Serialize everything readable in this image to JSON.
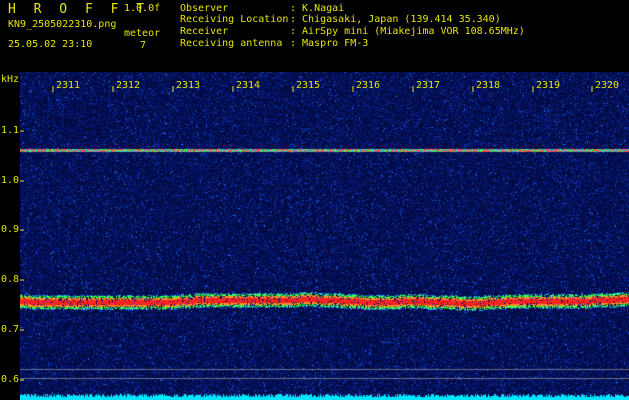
{
  "header": {
    "app_title": "H R O F F T",
    "version": "1.0.0f",
    "file_name": "KN9_2505022310.png",
    "timestamp": "25.05.02 23:10",
    "meteor_label": "meteor",
    "meteor_count": "7",
    "metadata": [
      {
        "label": "Observer",
        "value": ": K.Nagai"
      },
      {
        "label": "Receiving Location",
        "value": ": Chigasaki, Japan (139.414 35.340)"
      },
      {
        "label": "Receiver",
        "value": ": AirSpy mini (Miakejima VOR 108.65MHz)"
      },
      {
        "label": "Receiving antenna",
        "value": ": Maspro FM-3"
      }
    ]
  },
  "axes": {
    "y_unit": "kHz",
    "y_ticks": [
      "1.1",
      "1.0",
      "0.9",
      "0.8",
      "0.7",
      "0.6"
    ],
    "x_ticks": [
      "2311",
      "2312",
      "2313",
      "2314",
      "2315",
      "2316",
      "2317",
      "2318",
      "2319",
      "2320"
    ]
  },
  "colors": {
    "text": "#e6e600",
    "background": "#000000",
    "noise_dark": "#0a1a6b",
    "noise_light": "#2b6cff",
    "signal_strong": "#ff2a2a",
    "signal_mid": "#39ff4a",
    "baseline": "#00e6ff"
  }
}
